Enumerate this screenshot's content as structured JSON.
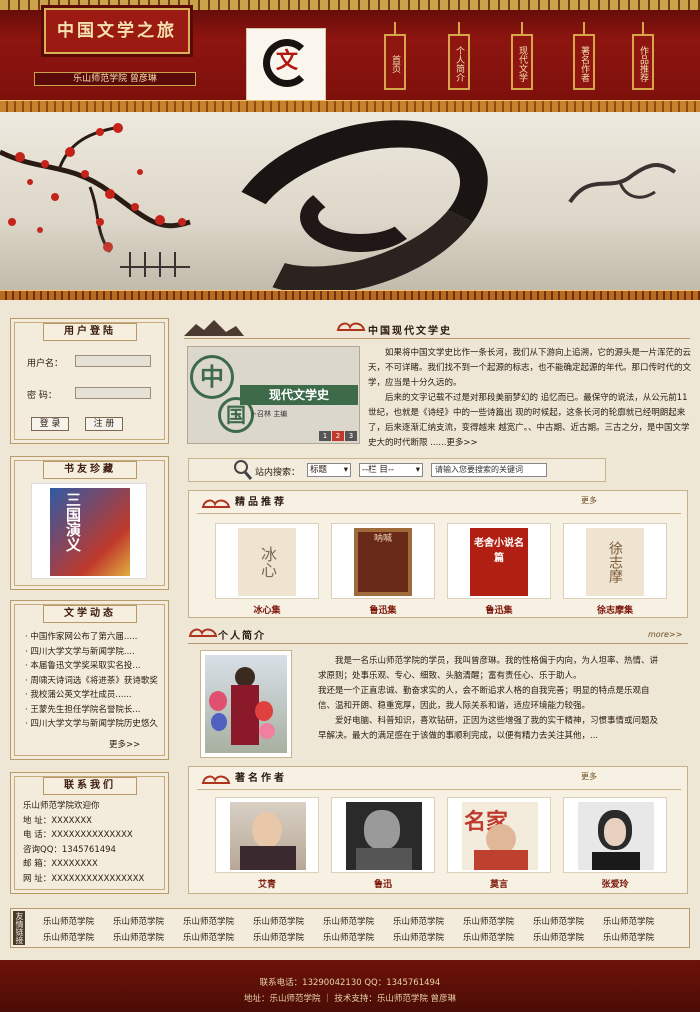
{
  "header": {
    "site_title": "中国文学之旅",
    "subtitle": "乐山师范学院 曾彦琳",
    "logo_char": "文",
    "nav": [
      "首页",
      "个人简介",
      "现代文学",
      "著名作者",
      "作品推荐"
    ]
  },
  "sidebar": {
    "login": {
      "title": "用户登陆",
      "username_label": "用户名：",
      "password_label": "密  码：",
      "login_button": "登 录",
      "register_button": "注 册"
    },
    "books": {
      "title": "书友珍藏",
      "book_title": "三国演义"
    },
    "news": {
      "title": "文学动态",
      "items": [
        "中国作家网公布了第六届.....",
        "四川大学文学与新闻学院....",
        "本届鲁迅文学奖采取实名投...",
        "周啸天诗词选《将进茶》获诗歌奖",
        "我校蒲公英文学社成员......",
        "王蒙先生担任学院名誉院长...",
        "四川大学文学与新闻学院历史悠久"
      ],
      "more": "更多>>"
    },
    "contact": {
      "title": "联系我们",
      "lines": [
        "乐山师范学院欢迎你",
        "地  址：XXXXXXX",
        "电  话：XXXXXXXXXXXXXX",
        "咨询QQ：1345761494",
        "邮  箱：XXXXXXXX",
        "网  址：XXXXXXXXXXXXXXXX"
      ]
    }
  },
  "history": {
    "heading": "中国现代文学史",
    "book_cover_char": "中",
    "book_cover_char2": "国",
    "book_cover_title": "现代文学史",
    "book_cover_author": "卜召林 主编",
    "pages": [
      "1",
      "2",
      "3"
    ],
    "paragraph1": "如果将中国文学史比作一条长河，我们从下游向上追溯，它的源头是一片浑茫的云天，不可详睹。我们找不到一个起源的标志，也不能确定起源的年代。那口传时代的文学，应当是十分久远的。",
    "paragraph2": "后来的文字记载不过是对那段美丽梦幻的 追忆而已。最保守的说法，从公元前11世纪，也就是《诗经》中的一些诗篇出 现的时候起，这条长河的轮廓就已经明朗起来了，后来逐渐汇纳支流，变得越来 越宽广。、中古期、近古期。三古之分，是中国文学史大的时代断限 ......更多>>"
  },
  "search": {
    "label": "站内搜索：",
    "select1": "标题",
    "select2": "--栏 目--",
    "placeholder": "请输入您要搜索的关键词"
  },
  "recommended": {
    "title": "精品推荐",
    "more": "更多",
    "items": [
      {
        "label": "冰心集",
        "cover_text": "冰心"
      },
      {
        "label": "鲁迅集",
        "cover_text": "呐喊"
      },
      {
        "label": "鲁迅集",
        "cover_text": "老舍小说名篇"
      },
      {
        "label": "徐志摩集",
        "cover_text": "徐志摩"
      }
    ]
  },
  "profile": {
    "title": "个人简介",
    "more": "more>>",
    "paragraph1": "我是一名乐山师范学院的学员，我叫曾彦琳。我的性格偏于内向，为人坦率、热情、讲求原则；处事乐观、专心、细致、头脑清醒；富有责任心、乐于助人。",
    "paragraph2": "我还是一个正直忠诚、勤奋求实的人，会不断追求人格的自我完善；明显的特点是乐观自信、温和开朗、稳重宽厚，因此，我人际关系和谐，适应环境能力较强。",
    "paragraph3": "爱好电脑、科普知识，喜欢钻研，正因为这些增强了我的实干精神，习惯事情或问题及早解决。最大的满足感在于该做的事顺利完成，以便有精力去关注其他，..."
  },
  "authors": {
    "title": "著名作者",
    "more": "更多",
    "items": [
      {
        "label": "艾青"
      },
      {
        "label": "鲁迅"
      },
      {
        "label": "莫言",
        "banner_text": "名家"
      },
      {
        "label": "张爱玲"
      }
    ]
  },
  "links": {
    "tag": "友情链接",
    "items": [
      "乐山师范学院",
      "乐山师范学院",
      "乐山师范学院",
      "乐山师范学院",
      "乐山师范学院",
      "乐山师范学院",
      "乐山师范学院",
      "乐山师范学院",
      "乐山师范学院",
      "乐山师范学院",
      "乐山师范学院",
      "乐山师范学院",
      "乐山师范学院",
      "乐山师范学院",
      "乐山师范学院",
      "乐山师范学院",
      "乐山师范学院",
      "乐山师范学院"
    ]
  },
  "footer": {
    "line1": "联系电话：13290042130    QQ：1345761494",
    "line2": "地址：乐山师范学院   ｜  技术支持：乐山师范学院 曾彦琳"
  },
  "colors": {
    "primary_red": "#8e1510",
    "gold": "#d8a64a",
    "paper": "#efe7d6"
  }
}
